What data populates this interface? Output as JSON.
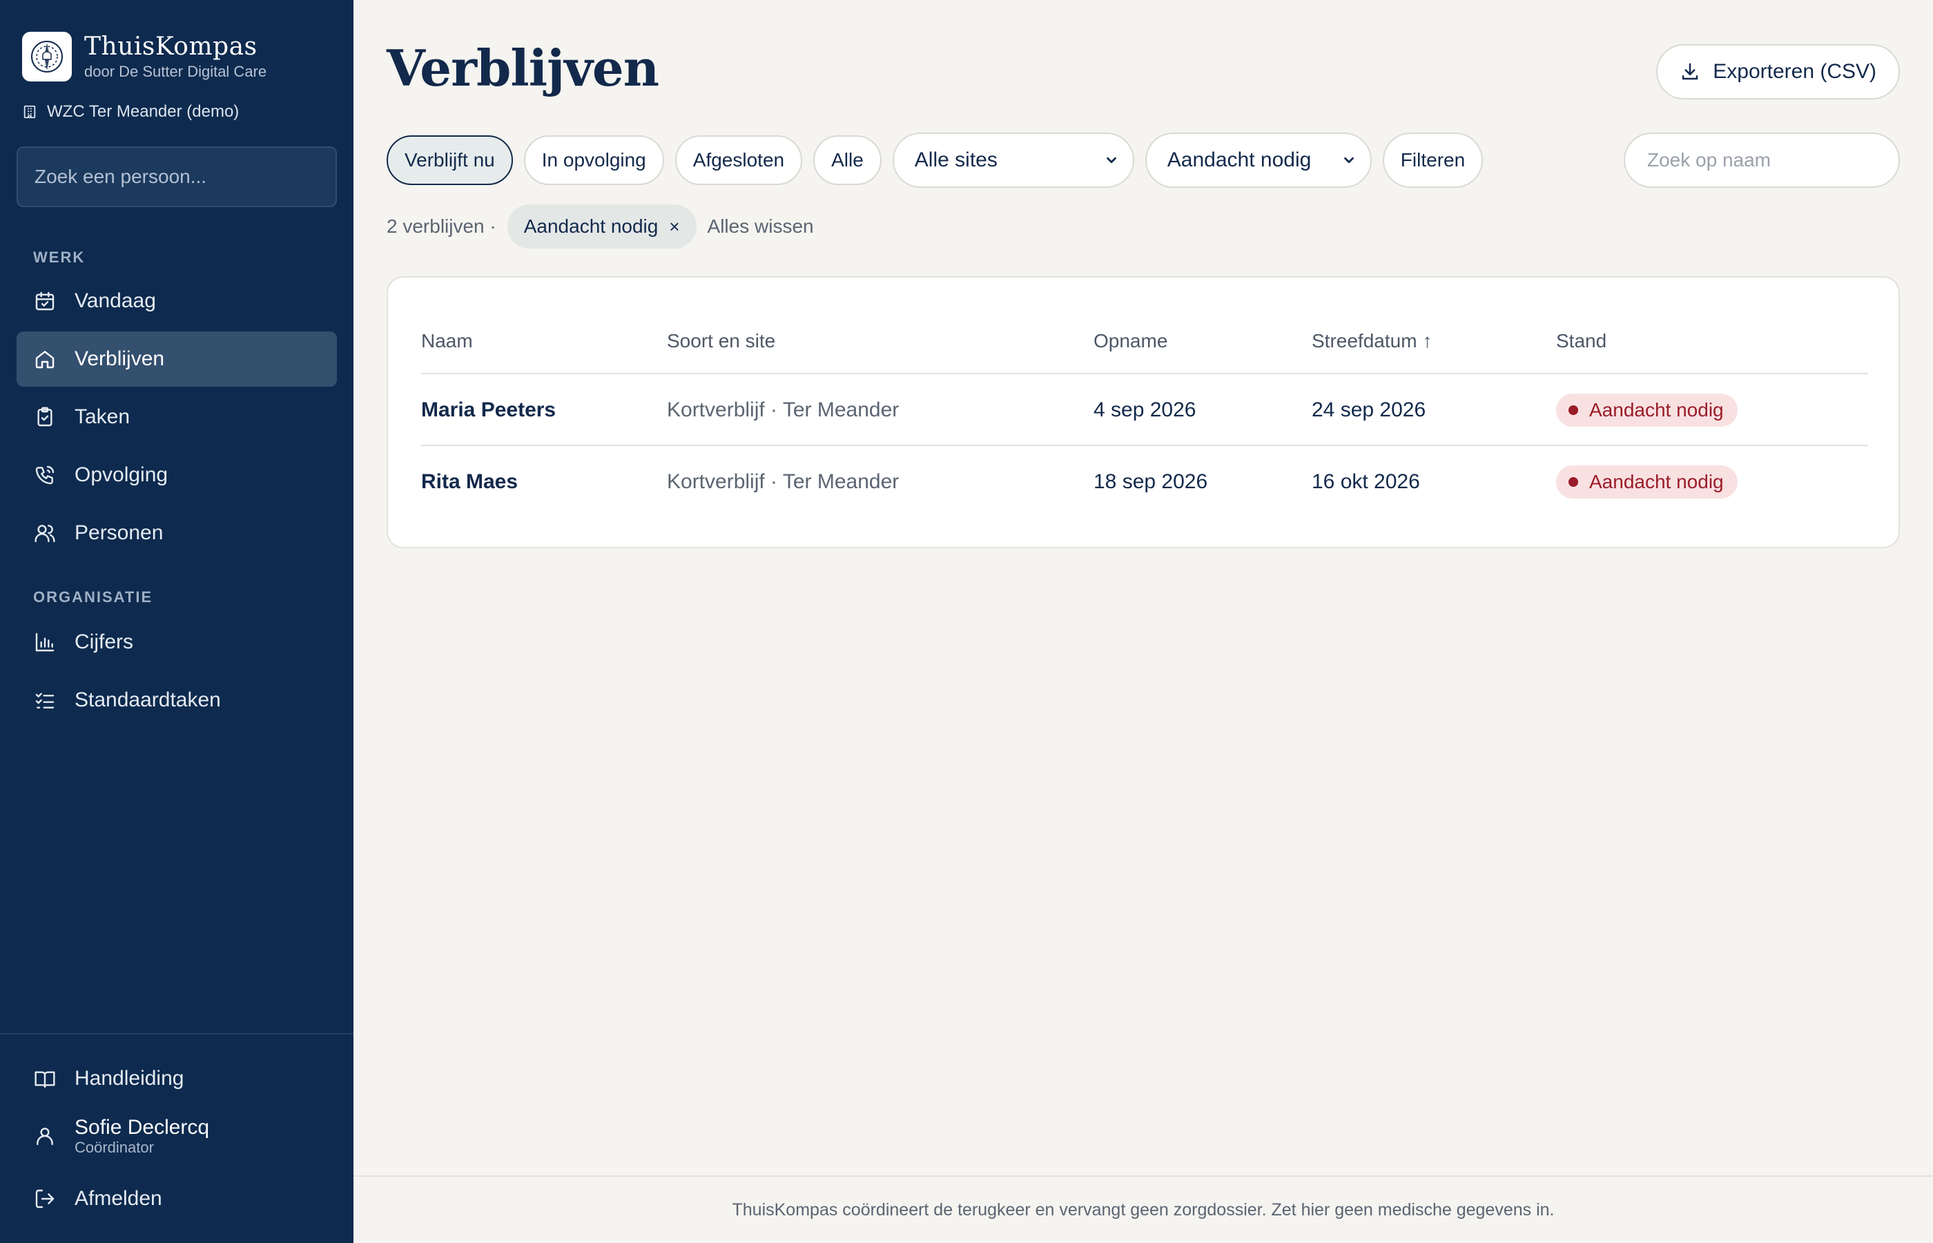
{
  "brand": {
    "name": "ThuisKompas",
    "subtitle": "door De Sutter Digital Care"
  },
  "org": {
    "name": "WZC Ter Meander (demo)"
  },
  "sidebar": {
    "search_placeholder": "Zoek een persoon...",
    "section_work": "WERK",
    "section_org": "ORGANISATIE",
    "items": [
      {
        "label": "Vandaag",
        "icon": "calendar-check-icon",
        "active": false
      },
      {
        "label": "Verblijven",
        "icon": "home-icon",
        "active": true
      },
      {
        "label": "Taken",
        "icon": "clipboard-check-icon",
        "active": false
      },
      {
        "label": "Opvolging",
        "icon": "phone-icon",
        "active": false
      },
      {
        "label": "Personen",
        "icon": "users-icon",
        "active": false
      }
    ],
    "org_items": [
      {
        "label": "Cijfers",
        "icon": "bar-chart-icon"
      },
      {
        "label": "Standaardtaken",
        "icon": "checklist-icon"
      }
    ],
    "bottom": {
      "manual": "Handleiding",
      "user_name": "Sofie Declercq",
      "user_role": "Coördinator",
      "logout": "Afmelden"
    }
  },
  "main": {
    "title": "Verblijven",
    "export_label": "Exporteren (CSV)",
    "tabs": [
      "Verblijft nu",
      "In opvolging",
      "Afgesloten",
      "Alle"
    ],
    "selected_tab": "Verblijft nu",
    "site_select": "Alle sites",
    "status_select": "Aandacht nodig",
    "filter_button": "Filteren",
    "name_search_placeholder": "Zoek op naam",
    "result_count": "2 verblijven ·",
    "active_chip": "Aandacht nodig",
    "chip_close": "×",
    "clear_all": "Alles wissen",
    "table": {
      "headers": {
        "naam": "Naam",
        "soort": "Soort en site",
        "opname": "Opname",
        "streefdatum": "Streefdatum",
        "stand": "Stand"
      },
      "sort_arrow": "↑",
      "rows": [
        {
          "naam": "Maria Peeters",
          "soort": "Kortverblijf · Ter Meander",
          "opname": "4 sep 2026",
          "streefdatum": "24 sep 2026",
          "stand": "Aandacht nodig"
        },
        {
          "naam": "Rita Maes",
          "soort": "Kortverblijf · Ter Meander",
          "opname": "18 sep 2026",
          "streefdatum": "16 okt 2026",
          "stand": "Aandacht nodig"
        }
      ]
    },
    "footer": "ThuisKompas coördineert de terugkeer en vervangt geen zorgdossier. Zet hier geen medische gegevens in."
  },
  "colors": {
    "sidebar_bg": "#0e2a4e",
    "accent": "#13294b",
    "page_bg": "#f5f4f0",
    "alert": "#9a1c2a",
    "alert_bg": "#f9e1e1"
  }
}
